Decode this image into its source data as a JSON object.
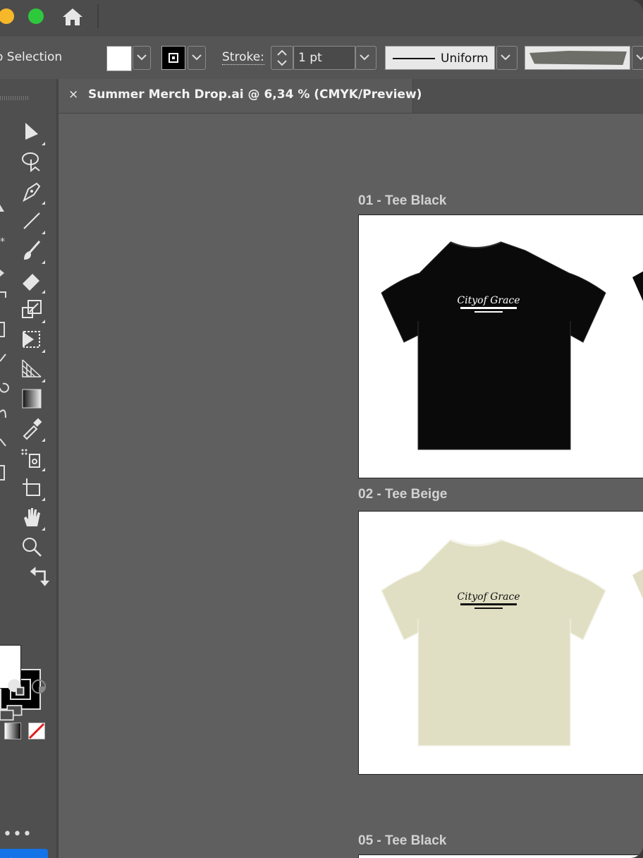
{
  "control_bar": {
    "selection_label": "o Selection",
    "stroke_label": "Stroke:",
    "stroke_weight": "1 pt",
    "profile_label": "Uniform"
  },
  "document_tab": {
    "close_glyph": "×",
    "title": "Summer Merch Drop.ai @ 6,34 % (CMYK/Preview)"
  },
  "artboards": [
    {
      "label": "01 - Tee Black",
      "shirt_color": "#0a0a0a",
      "print_color": "#ffffff"
    },
    {
      "label": "02 - Tee Beige",
      "shirt_color": "#e1dfc3",
      "print_color": "#111111"
    },
    {
      "label": "05 - Tee Black",
      "shirt_color": "#0a0a0a",
      "print_color": "#ffffff"
    }
  ],
  "tools_panel": {
    "more_label": "•••"
  },
  "colors": {
    "ui_bg": "#5f5f5f",
    "panel": "#4f4f4f",
    "accent_blue": "#1473e6",
    "traffic_yellow": "#f6b829",
    "traffic_green": "#2ec83d"
  }
}
